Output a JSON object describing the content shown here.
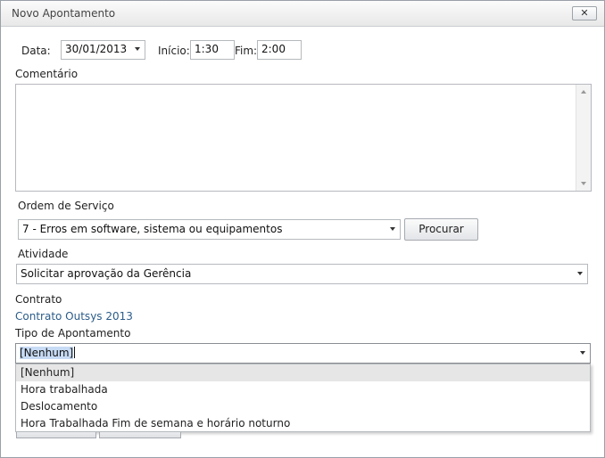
{
  "dialog": {
    "title": "Novo Apontamento",
    "close_label": "✕"
  },
  "form": {
    "data_label": "Data:",
    "data_value": "30/01/2013",
    "inicio_label": "Início:",
    "inicio_value": "1:30",
    "fim_label": "Fim:",
    "fim_value": "2:00",
    "comentario_label": "Comentário",
    "comentario_value": "",
    "ordem_label": "Ordem de Serviço",
    "ordem_value": "7 - Erros em software, sistema ou equipamentos",
    "procurar_label": "Procurar",
    "atividade_label": "Atividade",
    "atividade_value": "Solicitar aprovação da Gerência",
    "contrato_label": "Contrato",
    "contrato_value": "Contrato Outsys 2013",
    "tipo_label": "Tipo de Apontamento",
    "tipo_value": "[Nenhum]"
  },
  "tipo_options": [
    "[Nenhum]",
    "Hora trabalhada",
    "Deslocamento",
    "Hora Trabalhada Fim de semana e horário noturno"
  ]
}
